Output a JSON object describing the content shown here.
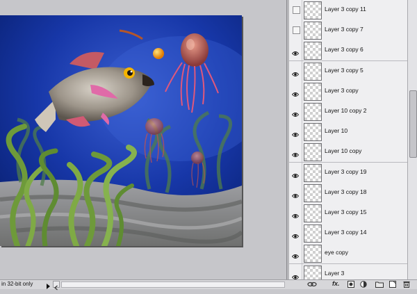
{
  "layers": [
    {
      "name": "Layer 3 copy 11",
      "visible": false
    },
    {
      "name": "Layer 3 copy 7",
      "visible": false
    },
    {
      "name": "Layer 3 copy 6",
      "visible": true
    },
    {
      "name": "Layer 3 copy 5",
      "visible": true
    },
    {
      "name": "Layer 3 copy",
      "visible": true
    },
    {
      "name": "Layer 10 copy 2",
      "visible": true
    },
    {
      "name": "Layer 10",
      "visible": true
    },
    {
      "name": "Layer 10 copy",
      "visible": true
    },
    {
      "name": "Layer 3 copy 19",
      "visible": true
    },
    {
      "name": "Layer 3 copy 18",
      "visible": true
    },
    {
      "name": "Layer 3 copy 15",
      "visible": true
    },
    {
      "name": "Layer 3 copy 14",
      "visible": true
    },
    {
      "name": "eye copy",
      "visible": true
    },
    {
      "name": "Layer 3",
      "visible": true
    }
  ],
  "status_bar": {
    "text": "in 32-bit only"
  },
  "footer": {
    "fx_label": "fx."
  },
  "colors": {
    "water_deep": "#0b2a8a",
    "seabed": "#8a8a88",
    "panel_bg": "#efeff1"
  },
  "icons": [
    "eye-icon",
    "link-icon",
    "fx-icon",
    "mask-icon",
    "adjustment-icon",
    "group-folder-icon",
    "new-layer-icon",
    "trash-icon"
  ]
}
